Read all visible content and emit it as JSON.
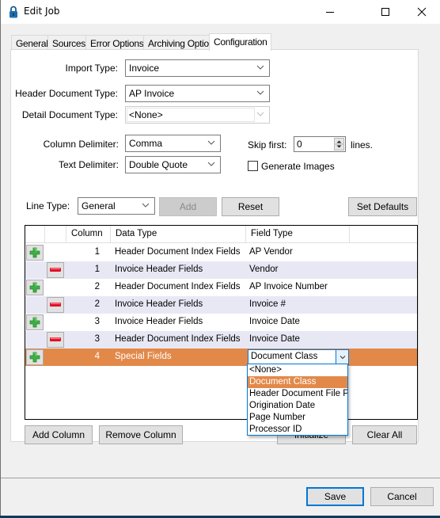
{
  "window": {
    "title": "Edit Job",
    "icon": "lock-icon",
    "controls": [
      "minimize-icon",
      "maximize-icon",
      "close-icon"
    ]
  },
  "tabs": [
    {
      "label": "General",
      "active": false
    },
    {
      "label": "Sources",
      "active": false
    },
    {
      "label": "Error Options",
      "active": false
    },
    {
      "label": "Archiving Options",
      "active": false
    },
    {
      "label": "Configuration",
      "active": true
    }
  ],
  "form": {
    "import_type": {
      "label": "Import Type:",
      "value": "Invoice"
    },
    "header_document_type": {
      "label": "Header Document Type:",
      "value": "AP Invoice"
    },
    "detail_document_type": {
      "label": "Detail Document Type:",
      "value": "<None>",
      "disabled": true
    },
    "column_delimiter": {
      "label": "Column Delimiter:",
      "value": "Comma"
    },
    "text_delimiter": {
      "label": "Text Delimiter:",
      "value": "Double Quote"
    },
    "skip_first": {
      "label": "Skip first:",
      "value": "0",
      "suffix": "lines."
    },
    "generate_images": {
      "label": "Generate Images",
      "checked": false
    },
    "line_type": {
      "label": "Line Type:",
      "value": "General"
    }
  },
  "buttons": {
    "add": "Add",
    "reset": "Reset",
    "set_defaults": "Set Defaults",
    "add_column": "Add Column",
    "remove_column": "Remove Column",
    "initialize": "Initialize",
    "clear_all": "Clear All",
    "save": "Save",
    "cancel": "Cancel"
  },
  "grid": {
    "columns": [
      "",
      "",
      "Column",
      "Data Type",
      "Field Type",
      ""
    ],
    "rows": [
      {
        "action": "add",
        "column": "1",
        "data_type": "Header Document Index Fields",
        "field_type": "AP Vendor",
        "style": "normal"
      },
      {
        "action": "remove",
        "column": "1",
        "data_type": "Invoice Header Fields",
        "field_type": "Vendor",
        "style": "alt"
      },
      {
        "action": "add",
        "column": "2",
        "data_type": "Header Document Index Fields",
        "field_type": "AP Invoice Number",
        "style": "normal"
      },
      {
        "action": "remove",
        "column": "2",
        "data_type": "Invoice Header Fields",
        "field_type": "Invoice #",
        "style": "alt"
      },
      {
        "action": "add",
        "column": "3",
        "data_type": "Invoice Header Fields",
        "field_type": "Invoice Date",
        "style": "normal"
      },
      {
        "action": "remove",
        "column": "3",
        "data_type": "Header Document Index Fields",
        "field_type": "Invoice Date",
        "style": "alt"
      },
      {
        "action": "add",
        "column": "4",
        "data_type": "Special Fields",
        "field_type": "Document Class",
        "style": "selected"
      }
    ],
    "field_type_dropdown": {
      "options": [
        "<None>",
        "Document Class",
        "Header Document File Pa",
        "Origination Date",
        "Page Number",
        "Processor ID"
      ],
      "highlighted": "Document Class"
    }
  },
  "colors": {
    "selection": "#e2894a",
    "alt_row": "#e8e8f5",
    "focus": "#0078d7",
    "add_icon": "#3cb043",
    "remove_icon": "#e0102a"
  }
}
